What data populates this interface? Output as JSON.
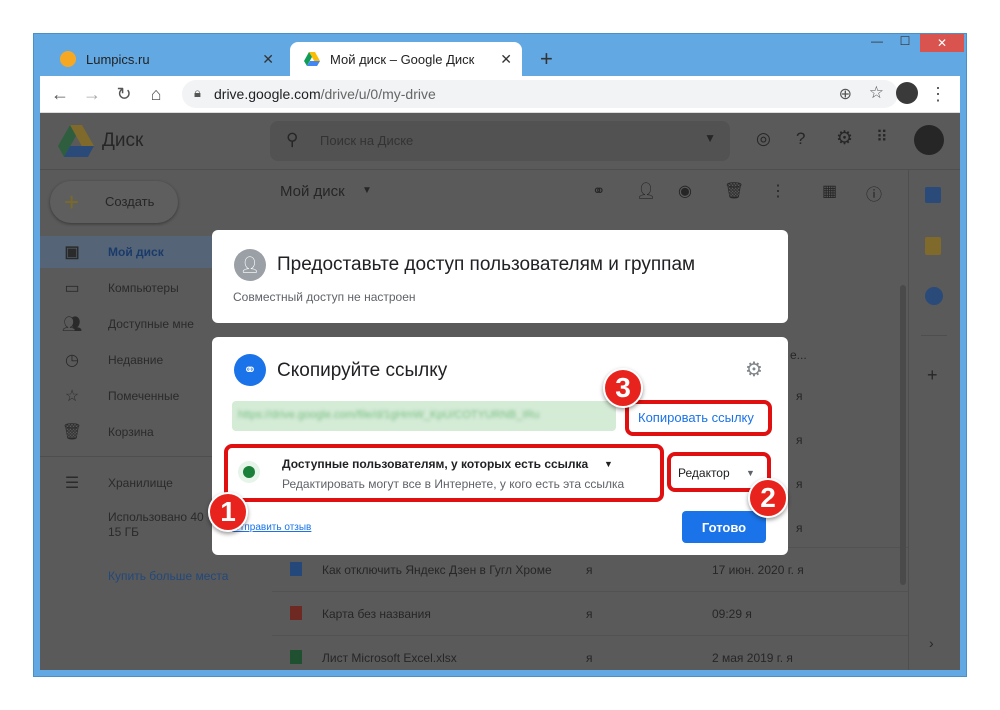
{
  "browser": {
    "tabs": [
      {
        "title": "Lumpics.ru",
        "close": "✕"
      },
      {
        "title": "Мой диск – Google Диск",
        "close": "✕"
      }
    ],
    "new_tab": "+",
    "window_controls": {
      "minimize": "—",
      "maximize": "☐",
      "close": "✕"
    },
    "url_host": "drive.google.com",
    "url_path": "/drive/u/0/my-drive"
  },
  "drive": {
    "app_name": "Диск",
    "search_placeholder": "Поиск на Диске",
    "create_label": "Создать",
    "breadcrumb": "Мой диск",
    "sidebar": [
      {
        "label": "Мой диск",
        "icon": "drive-icon"
      },
      {
        "label": "Компьютеры",
        "icon": "computer-icon"
      },
      {
        "label": "Доступные мне",
        "icon": "people-icon"
      },
      {
        "label": "Недавние",
        "icon": "clock-icon"
      },
      {
        "label": "Помеченные",
        "icon": "star-icon"
      },
      {
        "label": "Корзина",
        "icon": "trash-icon"
      }
    ],
    "storage_label": "Хранилище",
    "storage_usage_line1": "Использовано 40",
    "storage_usage_line2": "15 ГБ",
    "buy_storage": "Купить больше места",
    "files": [
      {
        "name": "Как отключить Яндекс Дзен в Гугл Хроме",
        "owner": "я",
        "modified": "17 июн. 2020 г. я"
      },
      {
        "name": "Карта без названия",
        "owner": "я",
        "modified": "09:29 я"
      },
      {
        "name": "Лист Microsoft Excel.xlsx",
        "owner": "я",
        "modified": "2 мая 2019 г. я"
      }
    ],
    "partial_col": [
      "е...",
      "я",
      "я",
      "я",
      "я"
    ]
  },
  "share_dialog": {
    "people_title": "Предоставьте доступ пользователям и группам",
    "people_subtitle": "Совместный доступ не настроен",
    "link_title": "Скопируйте ссылку",
    "link_url": "https://drive.google.com/file/d/1gHmW_KpU/COTYURNB_IRu",
    "copy_link": "Копировать ссылку",
    "access_title": "Доступные пользователям, у которых есть ссылка",
    "access_desc": "Редактировать могут все в Интернете, у кого есть эта ссылка",
    "role": "Редактор",
    "feedback": "Отправить отзыв",
    "done": "Готово"
  },
  "annotations": [
    "1",
    "2",
    "3"
  ],
  "colors": {
    "accent": "#1a73e8",
    "annotation_red": "#e01010",
    "window_frame": "#62a8e3"
  }
}
